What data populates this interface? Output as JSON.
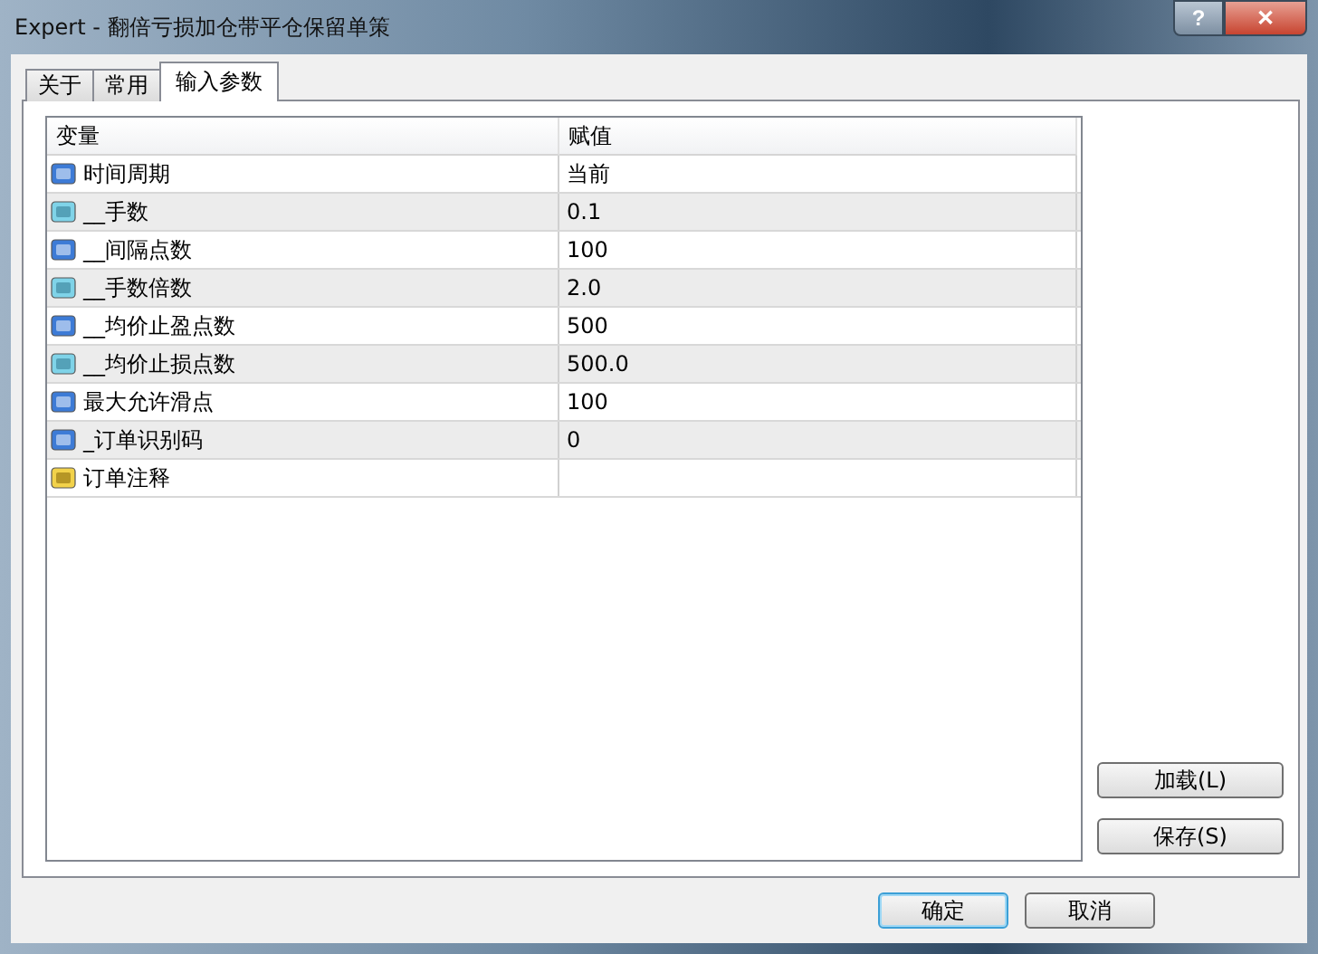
{
  "window": {
    "title": "Expert - 翻倍亏损加仓带平仓保留单策",
    "help": "?",
    "close": "✕"
  },
  "tabs": [
    {
      "label": "关于",
      "selected": false
    },
    {
      "label": "常用",
      "selected": false
    },
    {
      "label": "输入参数",
      "selected": true
    }
  ],
  "table": {
    "columns": [
      "变量",
      "赋值"
    ],
    "rows": [
      {
        "kind": "int",
        "name": "时间周期",
        "value": "当前"
      },
      {
        "kind": "double",
        "name": "__手数",
        "value": "0.1"
      },
      {
        "kind": "int",
        "name": "__间隔点数",
        "value": "100"
      },
      {
        "kind": "double",
        "name": "__手数倍数",
        "value": "2.0"
      },
      {
        "kind": "int",
        "name": "__均价止盈点数",
        "value": "500"
      },
      {
        "kind": "double",
        "name": "__均价止损点数",
        "value": "500.0"
      },
      {
        "kind": "int",
        "name": "最大允许滑点",
        "value": "100"
      },
      {
        "kind": "int",
        "name": "_订单识别码",
        "value": "0"
      },
      {
        "kind": "string",
        "name": "订单注释"
      }
    ]
  },
  "side_buttons": [
    "加载(L)",
    "保存(S)"
  ],
  "buttons": [
    {
      "label": "确定",
      "default": true
    },
    {
      "label": "取消",
      "default": false
    }
  ]
}
